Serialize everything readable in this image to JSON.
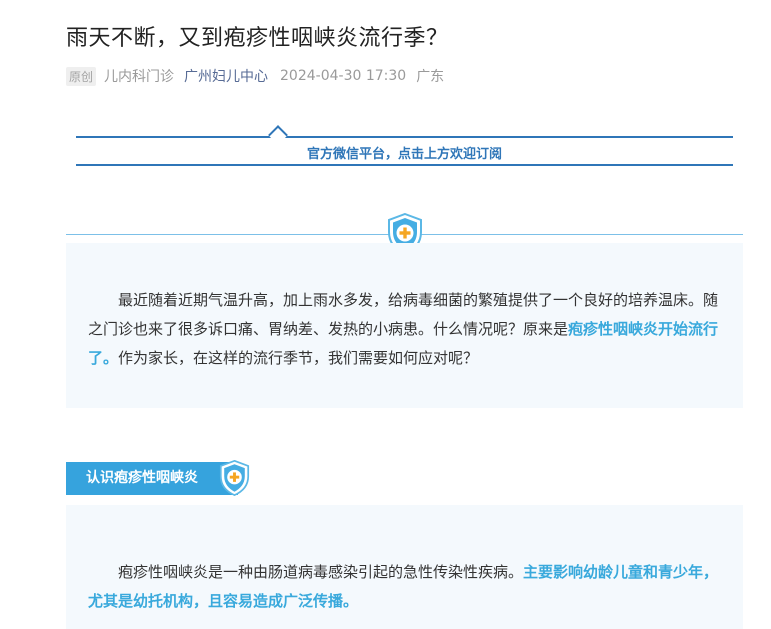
{
  "article": {
    "title": "雨天不断，又到疱疹性咽峡炎流行季？",
    "badge": "原创",
    "author": "儿内科门诊",
    "account": "广州妇儿中心",
    "datetime": "2024-04-30 17:30",
    "location": "广东"
  },
  "subscribe": {
    "text": "官方微信平台，点击上方欢迎订阅"
  },
  "intro": {
    "text_before": "最近随着近期气温升高，加上雨水多发，给病毒细菌的繁殖提供了一个良好的培养温床。随之门诊也来了很多诉口痛、胃纳差、发热的小病患。什么情况呢？原来是",
    "highlight": "疱疹性咽峡炎开始流行了。",
    "text_after": "作为家长，在这样的流行季节，我们需要如何应对呢？"
  },
  "section": {
    "heading": "认识疱疹性咽峡炎",
    "text_before": "疱疹性咽峡炎是一种由肠道病毒感染引起的急性传染性疾病。",
    "highlight": "主要影响幼龄儿童和青少年，尤其是幼托机构，且容易造成广泛传播。"
  },
  "colors": {
    "accent_blue": "#36a3dd",
    "link_blue": "#2f76b8",
    "box_bg": "#f4f9fd"
  },
  "icons": {
    "shield": "shield-plus-icon"
  }
}
